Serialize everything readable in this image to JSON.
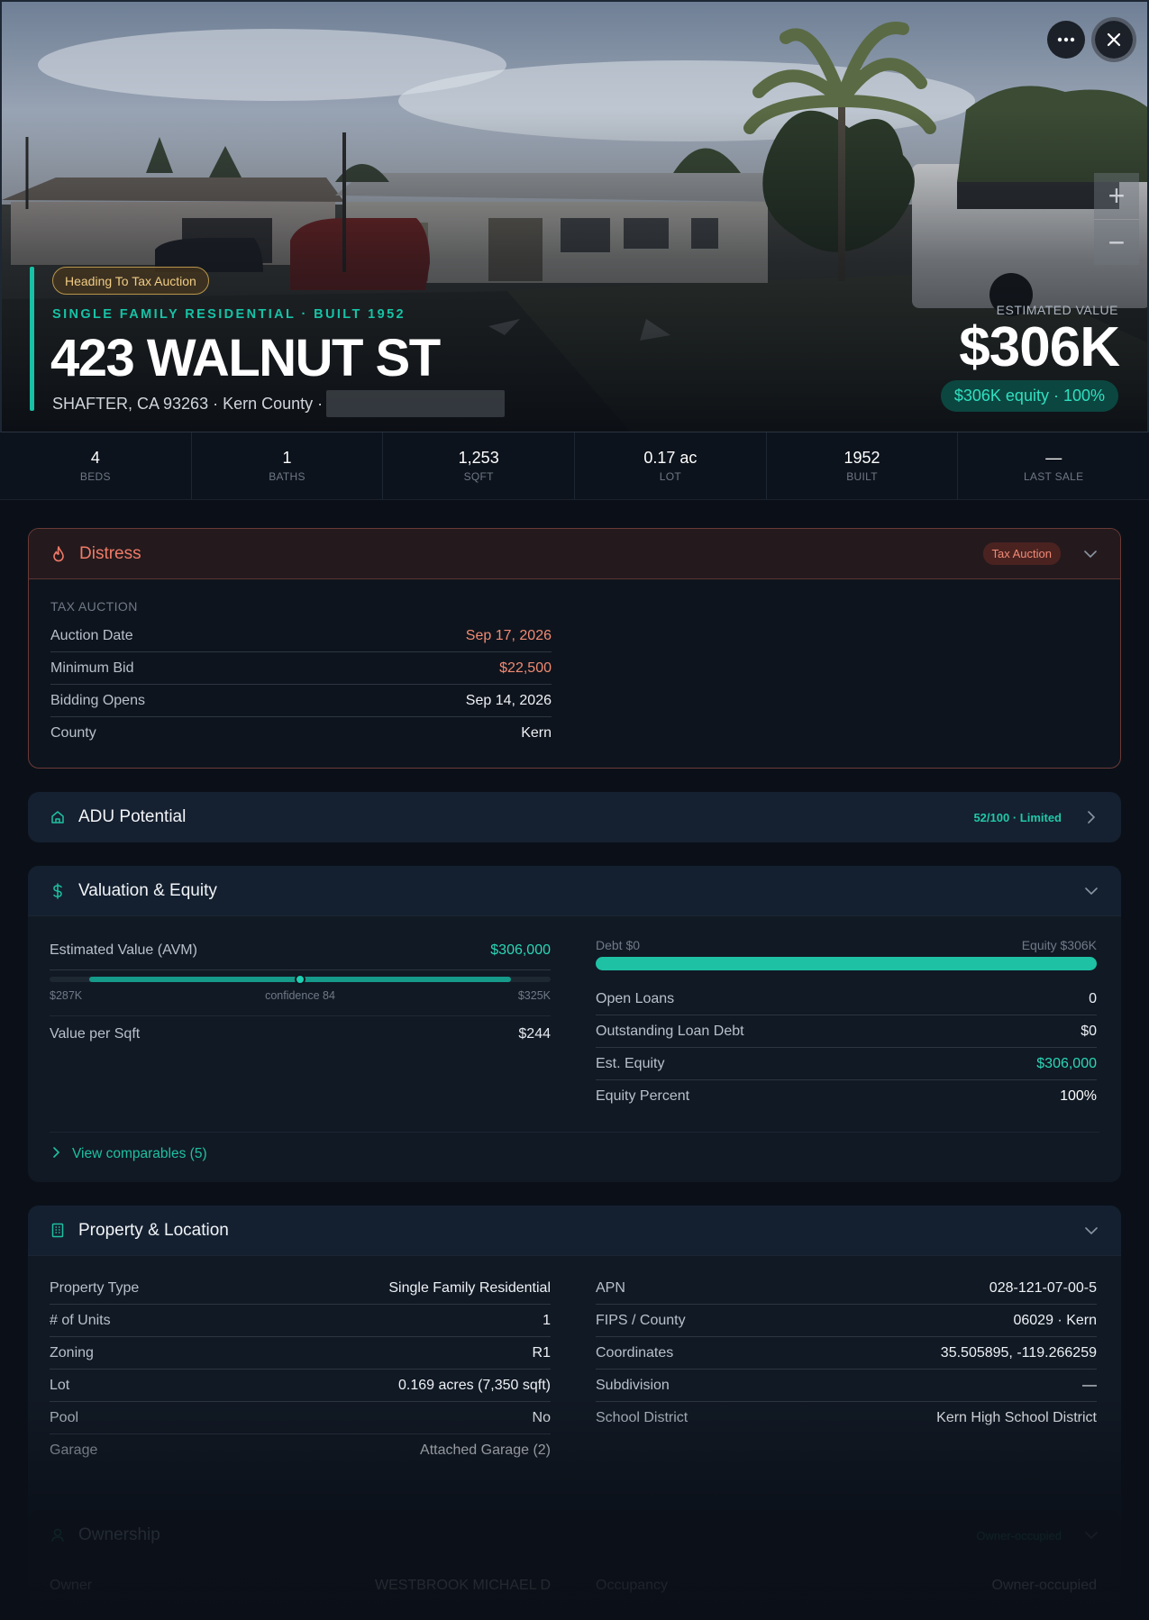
{
  "hero": {
    "status_badge": "Heading To Tax Auction",
    "subtitle": "SINGLE FAMILY RESIDENTIAL · BUILT 1952",
    "address": "423 WALNUT ST",
    "location": "SHAFTER, CA 93263 · Kern County ·",
    "estimated_value_label": "ESTIMATED VALUE",
    "estimated_value": "$306K",
    "equity_badge": "$306K equity · 100%",
    "more_icon": "ellipsis-icon",
    "close_icon": "close-icon",
    "zoom_in": "+",
    "zoom_out": "−",
    "nav_prev": "chevron-left-icon",
    "nav_next": "chevron-right-icon"
  },
  "stats": [
    {
      "value": "4",
      "label": "BEDS"
    },
    {
      "value": "1",
      "label": "BATHS"
    },
    {
      "value": "1,253",
      "label": "SQFT"
    },
    {
      "value": "0.17 ac",
      "label": "LOT"
    },
    {
      "value": "1952",
      "label": "BUILT"
    },
    {
      "value": "—",
      "label": "LAST SALE"
    }
  ],
  "distress": {
    "title": "Distress",
    "icon": "flame-icon",
    "badge": "Tax Auction",
    "section_caption": "TAX AUCTION",
    "rows": [
      {
        "label": "Auction Date",
        "value": "Sep 17, 2026"
      },
      {
        "label": "Minimum Bid",
        "value": "$22,500"
      },
      {
        "label": "Bidding Opens",
        "value": "Sep 14, 2026"
      },
      {
        "label": "County",
        "value": "Kern"
      }
    ]
  },
  "adu": {
    "title": "ADU Potential",
    "icon": "home-icon",
    "badge": "52/100 · Limited"
  },
  "valuation": {
    "title": "Valuation & Equity",
    "icon": "dollar-icon",
    "avm_label": "Estimated Value (AVM)",
    "avm_value": "$306,000",
    "range_low": "$287K",
    "confidence": "confidence 84",
    "range_high": "$325K",
    "avm_range_fill_start": 0.08,
    "avm_range_fill_end": 0.92,
    "avm_marker": 0.5,
    "vps_label": "Value per Sqft",
    "vps_value": "$244",
    "debt_label": "Debt $0",
    "equity_label": "Equity $306K",
    "equity_fraction": 1.0,
    "rows": [
      {
        "label": "Open Loans",
        "value": "0"
      },
      {
        "label": "Outstanding Loan Debt",
        "value": "$0"
      },
      {
        "label": "Est. Equity",
        "value": "$306,000"
      },
      {
        "label": "Equity Percent",
        "value": "100%"
      }
    ],
    "view_comparables": "View comparables (5)"
  },
  "property": {
    "title": "Property & Location",
    "icon": "building-icon",
    "left_rows": [
      {
        "label": "Property Type",
        "value": "Single Family Residential"
      },
      {
        "label": "# of Units",
        "value": "1"
      },
      {
        "label": "Zoning",
        "value": "R1"
      },
      {
        "label": "Lot",
        "value": "0.169 acres (7,350 sqft)"
      },
      {
        "label": "Pool",
        "value": "No"
      },
      {
        "label": "Garage",
        "value": "Attached Garage (2)"
      }
    ],
    "right_rows": [
      {
        "label": "APN",
        "value": "028-121-07-00-5"
      },
      {
        "label": "FIPS / County",
        "value": "06029 · Kern"
      },
      {
        "label": "Coordinates",
        "value": "35.505895, -119.266259"
      },
      {
        "label": "Subdivision",
        "value": "—"
      },
      {
        "label": "School District",
        "value": "Kern High School District"
      }
    ]
  },
  "ownership": {
    "title": "Ownership",
    "icon": "user-icon",
    "badge": "Owner-occupied",
    "left_label": "Owner",
    "left_value": "WESTBROOK MICHAEL D",
    "right_label": "Occupancy",
    "right_value": "Owner-occupied"
  },
  "colors": {
    "accent": "#17c2a6",
    "distress": "#f07a67",
    "background": "#0b1018"
  }
}
